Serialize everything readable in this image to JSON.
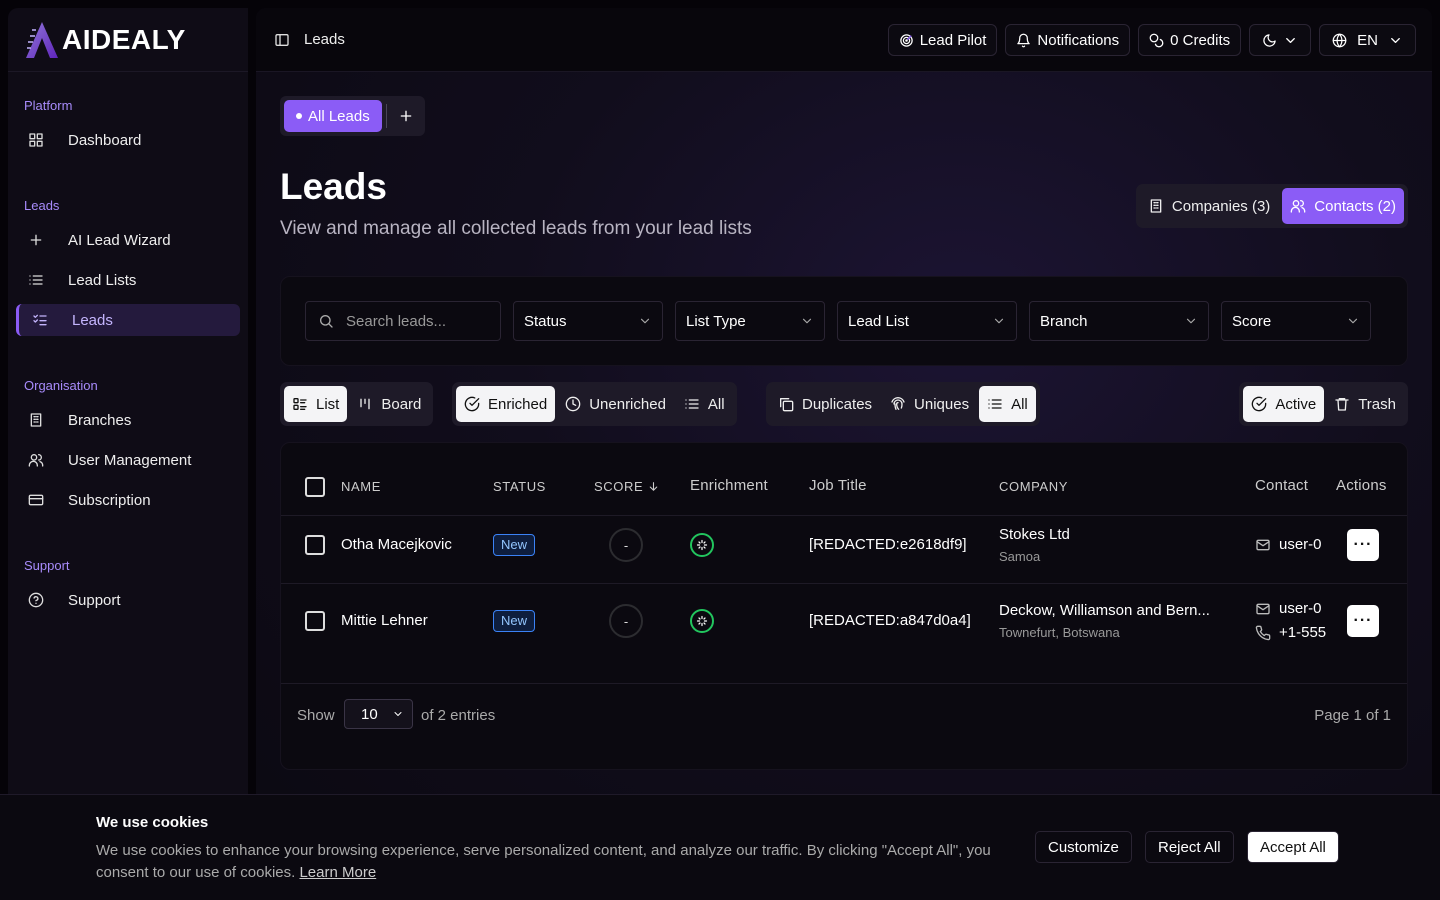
{
  "brand": {
    "name": "AIDEALY"
  },
  "sidebar": {
    "groups": [
      {
        "label": "Platform",
        "items": [
          {
            "label": "Dashboard",
            "icon": "grid-icon"
          }
        ]
      },
      {
        "label": "Leads",
        "items": [
          {
            "label": "AI Lead Wizard",
            "icon": "plus-icon"
          },
          {
            "label": "Lead Lists",
            "icon": "list-icon"
          },
          {
            "label": "Leads",
            "icon": "list-checks-icon",
            "active": true
          }
        ]
      },
      {
        "label": "Organisation",
        "items": [
          {
            "label": "Branches",
            "icon": "building-icon"
          },
          {
            "label": "User Management",
            "icon": "users-icon"
          },
          {
            "label": "Subscription",
            "icon": "credit-card-icon"
          }
        ]
      },
      {
        "label": "Support",
        "items": [
          {
            "label": "Support",
            "icon": "help-circle-icon"
          }
        ]
      }
    ]
  },
  "topbar": {
    "breadcrumb": "Leads",
    "lead_pilot": "Lead Pilot",
    "notifications": "Notifications",
    "credits": "0 Credits",
    "language": "EN"
  },
  "lead_tabs": {
    "active": "All Leads"
  },
  "header": {
    "title": "Leads",
    "subtitle": "View and manage all collected leads from your lead lists",
    "companies": "Companies (3)",
    "contacts": "Contacts (2)"
  },
  "filters": {
    "search_placeholder": "Search leads...",
    "status": "Status",
    "list_type": "List Type",
    "lead_list": "Lead List",
    "branch": "Branch",
    "score": "Score"
  },
  "view_toggle": {
    "list": "List",
    "board": "Board"
  },
  "enrichment_toggle": {
    "enriched": "Enriched",
    "unenriched": "Unenriched",
    "all": "All"
  },
  "duplicate_toggle": {
    "duplicates": "Duplicates",
    "uniques": "Uniques",
    "all": "All"
  },
  "state_toggle": {
    "active": "Active",
    "trash": "Trash"
  },
  "table": {
    "columns": {
      "name": "NAME",
      "status": "STATUS",
      "score": "SCORE",
      "enrichment": "Enrichment",
      "job_title": "Job Title",
      "company": "COMPANY",
      "contact": "Contact",
      "actions": "Actions"
    },
    "rows": [
      {
        "name": "Otha Macejkovic",
        "status": "New",
        "score": "-",
        "job_title": "[REDACTED:e2618df9]",
        "company": "Stokes Ltd",
        "location": "Samoa",
        "email": "user-0",
        "phone": ""
      },
      {
        "name": "Mittie Lehner",
        "status": "New",
        "score": "-",
        "job_title": "[REDACTED:a847d0a4]",
        "company": "Deckow, Williamson and Bern...",
        "location": "Townefurt, Botswana",
        "email": "user-0",
        "phone": "+1-555"
      }
    ]
  },
  "pagination": {
    "show": "Show",
    "page_size": "10",
    "entries": "of 2 entries",
    "page": "Page 1 of 1"
  },
  "cookie": {
    "title": "We use cookies",
    "text": "We use cookies to enhance your browsing experience, serve personalized content, and analyze our traffic. By clicking \"Accept All\", you consent to our use of cookies.",
    "learn_more": "Learn More",
    "customize": "Customize",
    "reject": "Reject All",
    "accept": "Accept All"
  },
  "colors": {
    "accent": "#8b5cf6",
    "success": "#22c55e",
    "badge": "#3b82f6"
  }
}
